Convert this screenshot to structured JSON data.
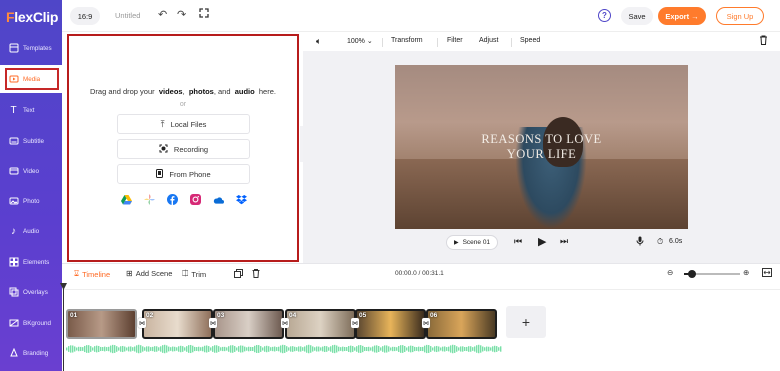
{
  "app": {
    "logo_prefix": "F",
    "logo_rest": "lexClip"
  },
  "sidebar": {
    "items": [
      {
        "label": "Templates",
        "icon": "templates-icon"
      },
      {
        "label": "Media",
        "icon": "media-icon"
      },
      {
        "label": "Text",
        "icon": "text-icon"
      },
      {
        "label": "Subtitle",
        "icon": "subtitle-icon"
      },
      {
        "label": "Video",
        "icon": "video-icon"
      },
      {
        "label": "Photo",
        "icon": "photo-icon"
      },
      {
        "label": "Audio",
        "icon": "audio-icon"
      },
      {
        "label": "Elements",
        "icon": "elements-icon"
      },
      {
        "label": "Overlays",
        "icon": "overlays-icon"
      },
      {
        "label": "BKground",
        "icon": "background-icon"
      },
      {
        "label": "Branding",
        "icon": "branding-icon"
      }
    ],
    "active": "Media"
  },
  "topbar": {
    "ratio": "16:9",
    "title": "Untitled",
    "save": "Save",
    "export": "Export →",
    "signup": "Sign Up",
    "help": "?"
  },
  "media_panel": {
    "drop_prefix": "Drag and drop your",
    "drop_videos": "videos",
    "drop_comma": ",",
    "drop_photos": "photos",
    "drop_and": ", and",
    "drop_audio": "audio",
    "drop_suffix": "here.",
    "or": "or",
    "buttons": {
      "local": "Local Files",
      "recording": "Recording",
      "phone": "From Phone"
    },
    "cloud_services": [
      "google-drive-icon",
      "google-photos-icon",
      "facebook-icon",
      "instagram-icon",
      "onedrive-icon",
      "dropbox-icon"
    ]
  },
  "edit_toolbar": {
    "zoom": "100%",
    "transform": "Transform",
    "filter": "Filter",
    "adjust": "Adjust",
    "speed": "Speed"
  },
  "preview": {
    "title_line1": "REASONS TO LOVE",
    "title_line2": "YOUR LIFE",
    "scene": "Scene 01",
    "duration": "6.0s"
  },
  "timeline_toolbar": {
    "timeline": "Timeline",
    "add_scene": "Add Scene",
    "trim": "Trim",
    "time": "00:00.0 / 00:31.1",
    "zoom_level": 0.1
  },
  "timeline": {
    "clips": [
      {
        "num": "01",
        "colors": [
          "#7a5b4a",
          "#b79a87",
          "#5c3f30"
        ]
      },
      {
        "num": "02",
        "colors": [
          "#c9b4a0",
          "#e8dccd",
          "#8e6f5a"
        ]
      },
      {
        "num": "03",
        "colors": [
          "#a8958a",
          "#d9cfc6",
          "#6d5a50"
        ]
      },
      {
        "num": "04",
        "colors": [
          "#b8a894",
          "#ddd2c3",
          "#7e6d5a"
        ]
      },
      {
        "num": "05",
        "colors": [
          "#5a4630",
          "#e8b45a",
          "#3a2c1e"
        ]
      },
      {
        "num": "06",
        "colors": [
          "#8a6a3a",
          "#d9a55a",
          "#4a3a24"
        ]
      }
    ],
    "add_label": "+",
    "audio_color": "#79e0a8"
  }
}
